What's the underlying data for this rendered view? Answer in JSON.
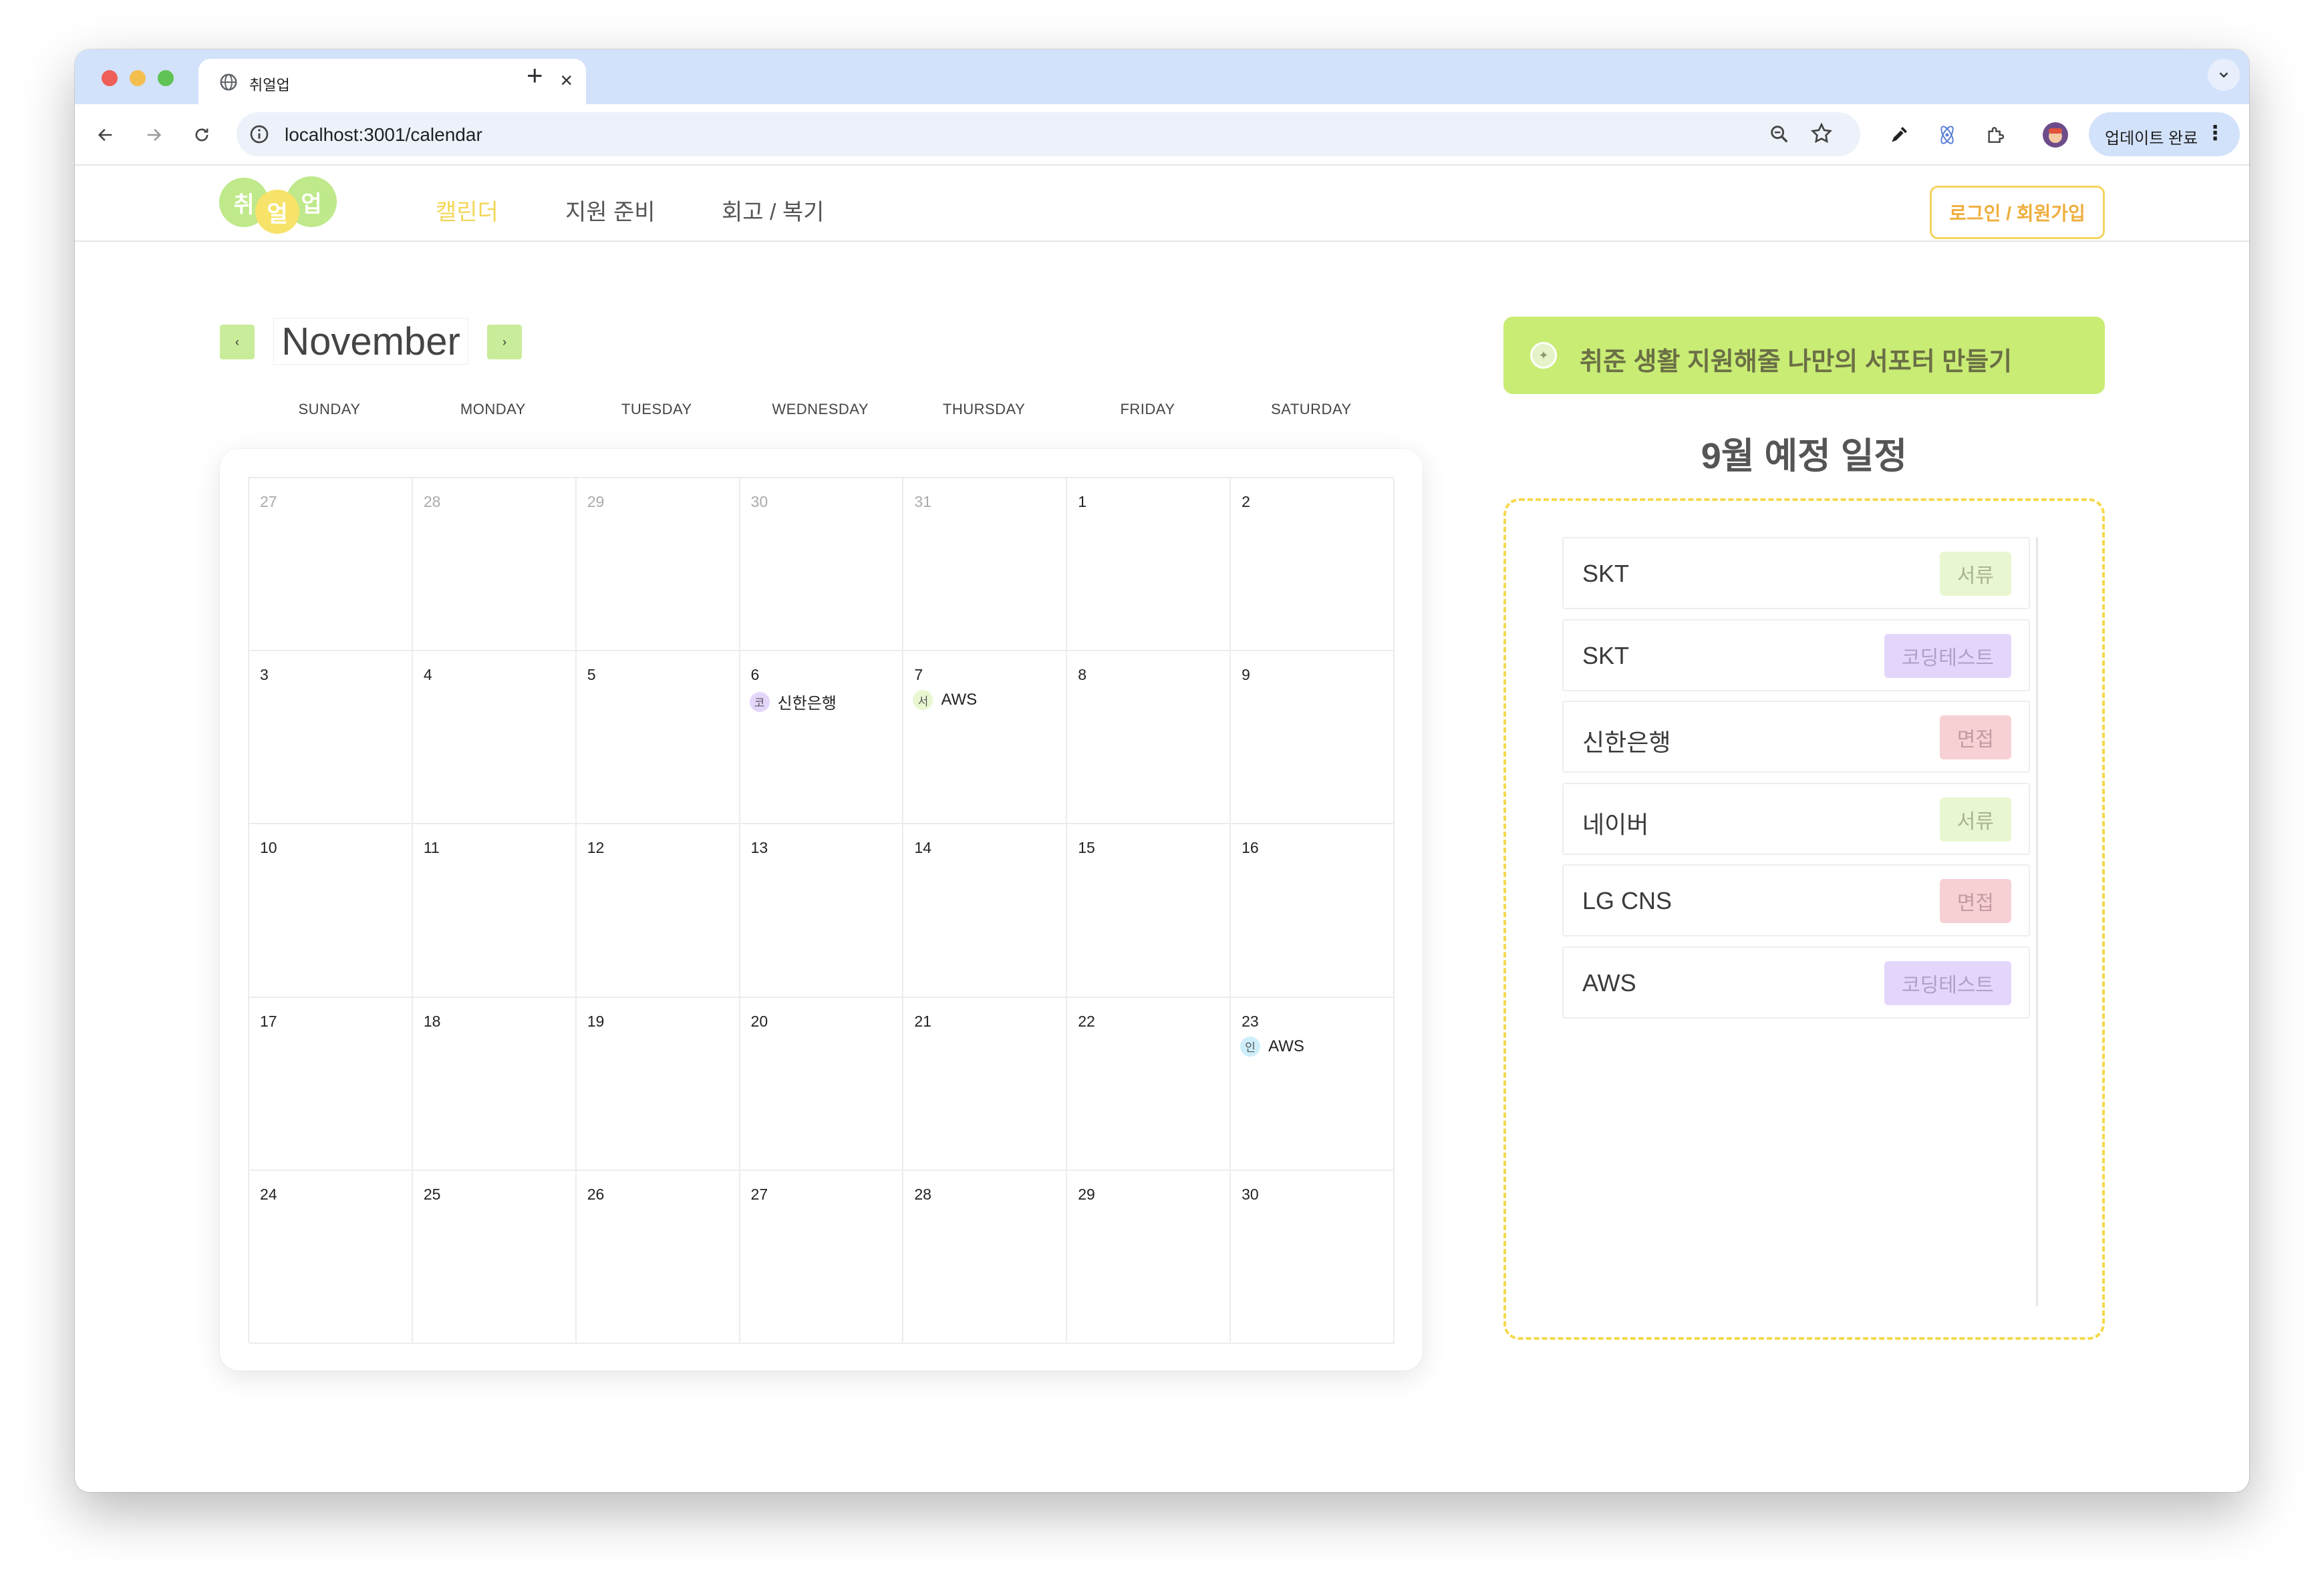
{
  "browser": {
    "tab_title": "취얼업",
    "url": "localhost:3001/calendar",
    "update_label": "업데이트 완료"
  },
  "app": {
    "logo_chars": [
      "취",
      "얼",
      "업"
    ],
    "nav": [
      "캘린더",
      "지원 준비",
      "회고 / 복기"
    ],
    "login_label": "로그인 / 회원가입"
  },
  "calendar": {
    "month": "November",
    "prev_label": "‹",
    "next_label": "›",
    "weekdays": [
      "SUNDAY",
      "MONDAY",
      "TUESDAY",
      "WEDNESDAY",
      "THURSDAY",
      "FRIDAY",
      "SATURDAY"
    ],
    "weeks": [
      [
        {
          "d": "27",
          "dim": true
        },
        {
          "d": "28",
          "dim": true
        },
        {
          "d": "29",
          "dim": true
        },
        {
          "d": "30",
          "dim": true
        },
        {
          "d": "31",
          "dim": true
        },
        {
          "d": "1"
        },
        {
          "d": "2"
        }
      ],
      [
        {
          "d": "3"
        },
        {
          "d": "4"
        },
        {
          "d": "5"
        },
        {
          "d": "6",
          "event": {
            "badge": "코",
            "text": "신한은행",
            "color": "#e4d6fb"
          }
        },
        {
          "d": "7",
          "event": {
            "badge": "서",
            "text": "AWS",
            "color": "#e9f7d1"
          }
        },
        {
          "d": "8"
        },
        {
          "d": "9"
        }
      ],
      [
        {
          "d": "10"
        },
        {
          "d": "11"
        },
        {
          "d": "12"
        },
        {
          "d": "13"
        },
        {
          "d": "14"
        },
        {
          "d": "15"
        },
        {
          "d": "16"
        }
      ],
      [
        {
          "d": "17"
        },
        {
          "d": "18"
        },
        {
          "d": "19"
        },
        {
          "d": "20"
        },
        {
          "d": "21"
        },
        {
          "d": "22"
        },
        {
          "d": "23",
          "event": {
            "badge": "인",
            "text": "AWS",
            "color": "#cdeefa"
          }
        }
      ],
      [
        {
          "d": "24"
        },
        {
          "d": "25"
        },
        {
          "d": "26"
        },
        {
          "d": "27"
        },
        {
          "d": "28"
        },
        {
          "d": "29"
        },
        {
          "d": "30"
        }
      ]
    ]
  },
  "sidebar": {
    "supporter_label": "취준 생활 지원해줄 나만의 서포터 만들기",
    "schedule_title": "9월 예정 일정",
    "items": [
      {
        "company": "SKT",
        "tag": "서류",
        "type": "doc"
      },
      {
        "company": "SKT",
        "tag": "코딩테스트",
        "type": "code"
      },
      {
        "company": "신한은행",
        "tag": "면접",
        "type": "interview"
      },
      {
        "company": "네이버",
        "tag": "서류",
        "type": "doc"
      },
      {
        "company": "LG CNS",
        "tag": "면접",
        "type": "interview"
      },
      {
        "company": "AWS",
        "tag": "코딩테스트",
        "type": "code"
      }
    ]
  },
  "colors": {
    "accent_green": "#c9ec74",
    "accent_yellow": "#f5d94e",
    "nav_active": "#f3d659",
    "login_text": "#efae3d"
  }
}
